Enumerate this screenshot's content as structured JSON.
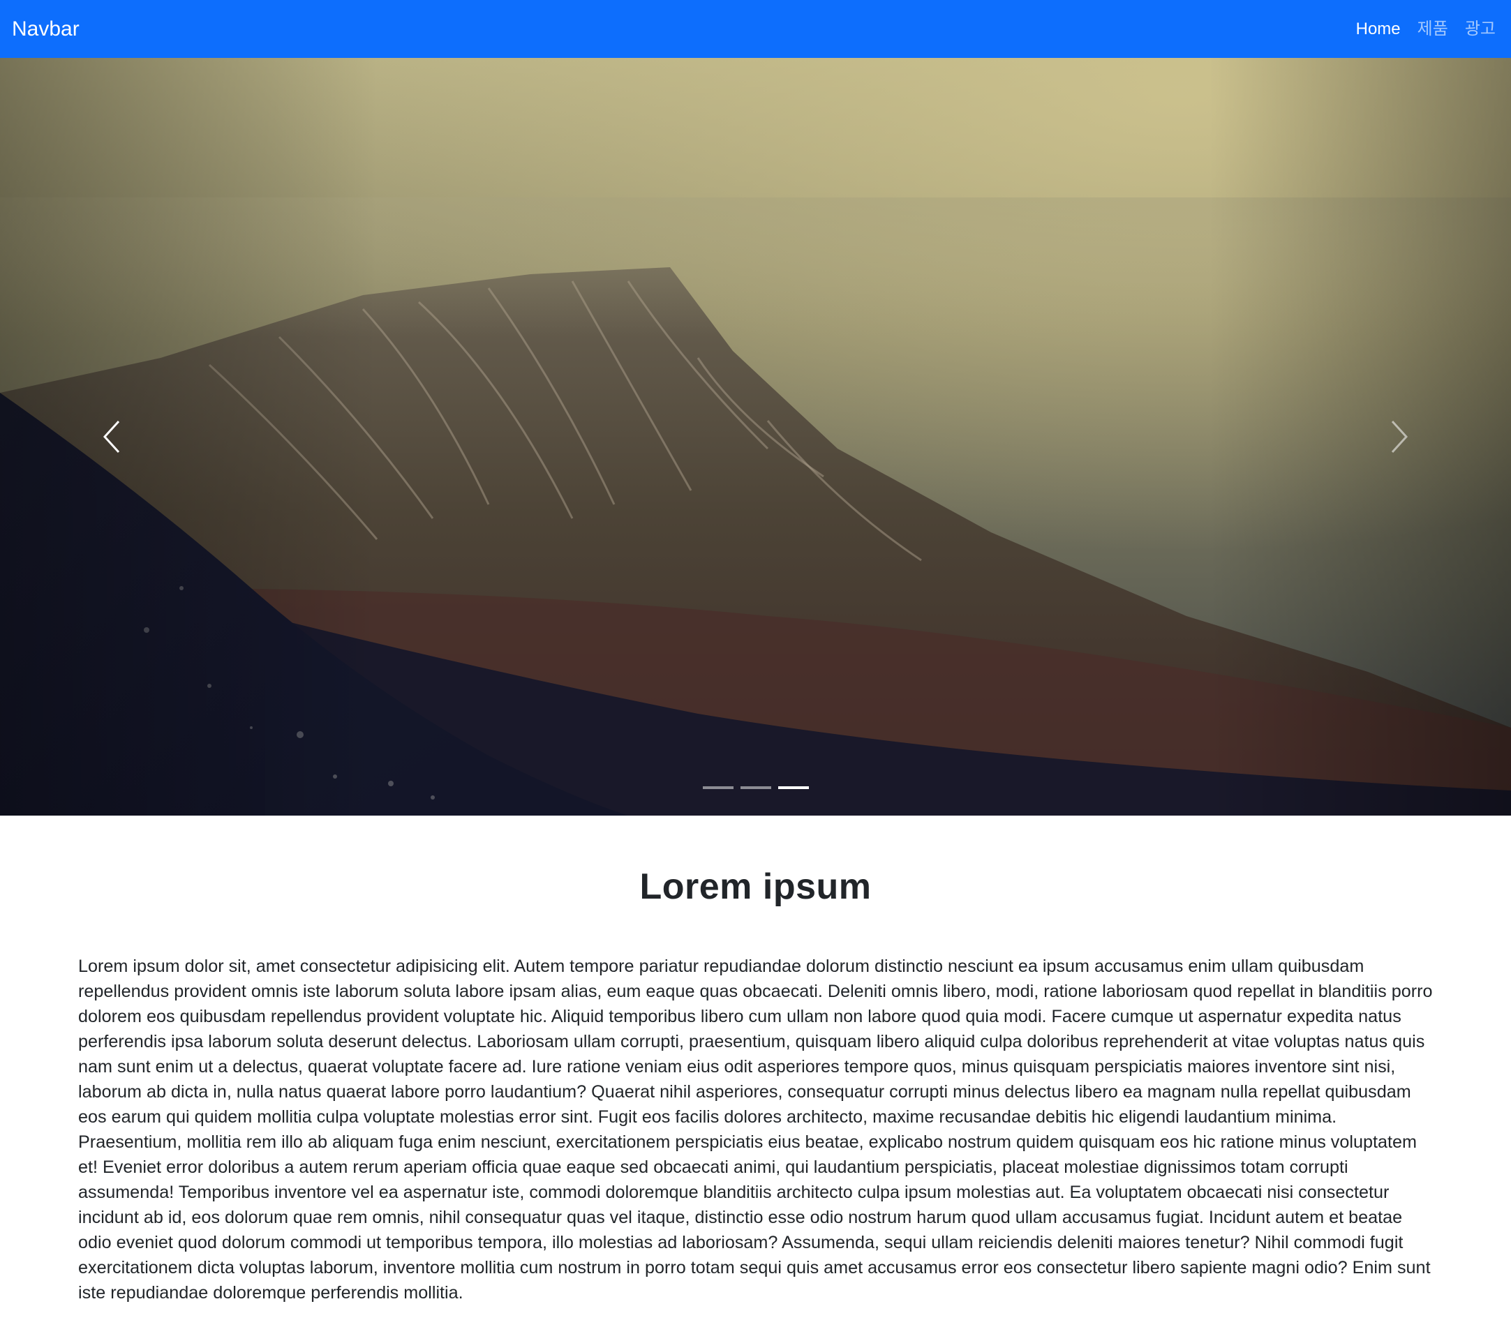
{
  "navbar": {
    "brand": "Navbar",
    "links": [
      {
        "label": "Home",
        "active": true
      },
      {
        "label": "제품",
        "active": false
      },
      {
        "label": "광고",
        "active": false
      }
    ],
    "background_color": "#0d6efd"
  },
  "carousel": {
    "slide_count": 3,
    "active_index": 2,
    "prev_icon": "chevron-left-icon",
    "next_icon": "chevron-right-icon",
    "image_description_icon": "mountain-photo"
  },
  "main": {
    "heading": "Lorem ipsum",
    "paragraph": "Lorem ipsum dolor sit, amet consectetur adipisicing elit. Autem tempore pariatur repudiandae dolorum distinctio nesciunt ea ipsum accusamus enim ullam quibusdam repellendus provident omnis iste laborum soluta labore ipsam alias, eum eaque quas obcaecati. Deleniti omnis libero, modi, ratione laboriosam quod repellat in blanditiis porro dolorem eos quibusdam repellendus provident voluptate hic. Aliquid temporibus libero cum ullam non labore quod quia modi. Facere cumque ut aspernatur expedita natus perferendis ipsa laborum soluta deserunt delectus. Laboriosam ullam corrupti, praesentium, quisquam libero aliquid culpa doloribus reprehenderit at vitae voluptas natus quis nam sunt enim ut a delectus, quaerat voluptate facere ad. Iure ratione veniam eius odit asperiores tempore quos, minus quisquam perspiciatis maiores inventore sint nisi, laborum ab dicta in, nulla natus quaerat labore porro laudantium? Quaerat nihil asperiores, consequatur corrupti minus delectus libero ea magnam nulla repellat quibusdam eos earum qui quidem mollitia culpa voluptate molestias error sint. Fugit eos facilis dolores architecto, maxime recusandae debitis hic eligendi laudantium minima. Praesentium, mollitia rem illo ab aliquam fuga enim nesciunt, exercitationem perspiciatis eius beatae, explicabo nostrum quidem quisquam eos hic ratione minus voluptatem et! Eveniet error doloribus a autem rerum aperiam officia quae eaque sed obcaecati animi, qui laudantium perspiciatis, placeat molestiae dignissimos totam corrupti assumenda! Temporibus inventore vel ea aspernatur iste, commodi doloremque blanditiis architecto culpa ipsum molestias aut. Ea voluptatem obcaecati nisi consectetur incidunt ab id, eos dolorum quae rem omnis, nihil consequatur quas vel itaque, distinctio esse odio nostrum harum quod ullam accusamus fugiat. Incidunt autem et beatae odio eveniet quod dolorum commodi ut temporibus tempora, illo molestias ad laboriosam? Assumenda, sequi ullam reiciendis deleniti maiores tenetur? Nihil commodi fugit exercitationem dicta voluptas laborum, inventore mollitia cum nostrum in porro totam sequi quis amet accusamus error eos consectetur libero sapiente magni odio? Enim sunt iste repudiandae doloremque perferendis mollitia."
  }
}
